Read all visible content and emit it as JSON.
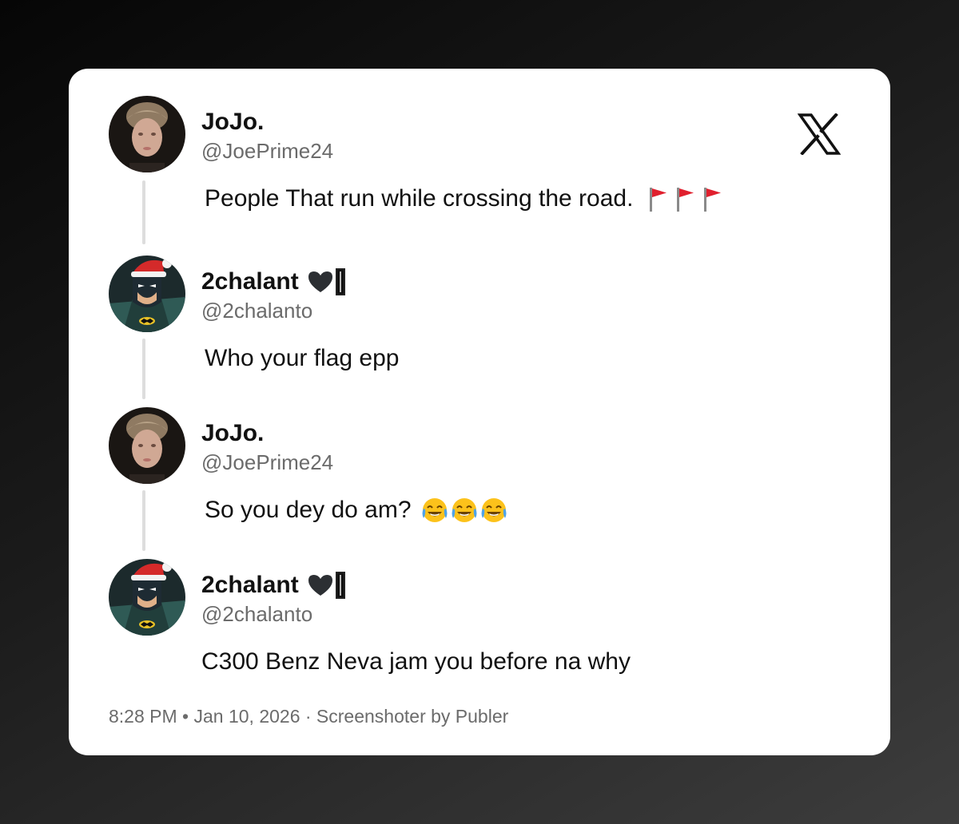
{
  "thread": {
    "posts": [
      {
        "author": "JoJo.",
        "handle": "@JoePrime24",
        "avatar": "face-photo-avatar",
        "text": "People That run while crossing the road.",
        "trailing_icons": [
          "red-flag-icon",
          "red-flag-icon",
          "red-flag-icon"
        ]
      },
      {
        "author": "2chalant",
        "handle": "@2chalanto",
        "avatar": "batman-santa-avatar",
        "name_icons": [
          "black-heart-icon",
          "flag-badge-icon"
        ],
        "text": "Who your flag epp"
      },
      {
        "author": "JoJo.",
        "handle": "@JoePrime24",
        "avatar": "face-photo-avatar",
        "text": "So you dey do am?",
        "trailing_icons": [
          "tears-of-joy-emoji",
          "tears-of-joy-emoji",
          "tears-of-joy-emoji"
        ]
      },
      {
        "author": "2chalant",
        "handle": "@2chalanto",
        "avatar": "batman-santa-avatar",
        "name_icons": [
          "black-heart-icon",
          "flag-badge-icon"
        ],
        "text": "C300 Benz Neva jam you before na why"
      }
    ]
  },
  "footer": {
    "text": "8:28 PM • Jan 10, 2026 · Screenshoter by Publer"
  },
  "brand": {
    "icon": "x-logo-icon"
  },
  "colors": {
    "card_background": "#ffffff",
    "name": "#111111",
    "handle": "#6b6b6b",
    "thread_line": "#dddddd",
    "flag": "#e0202e"
  }
}
